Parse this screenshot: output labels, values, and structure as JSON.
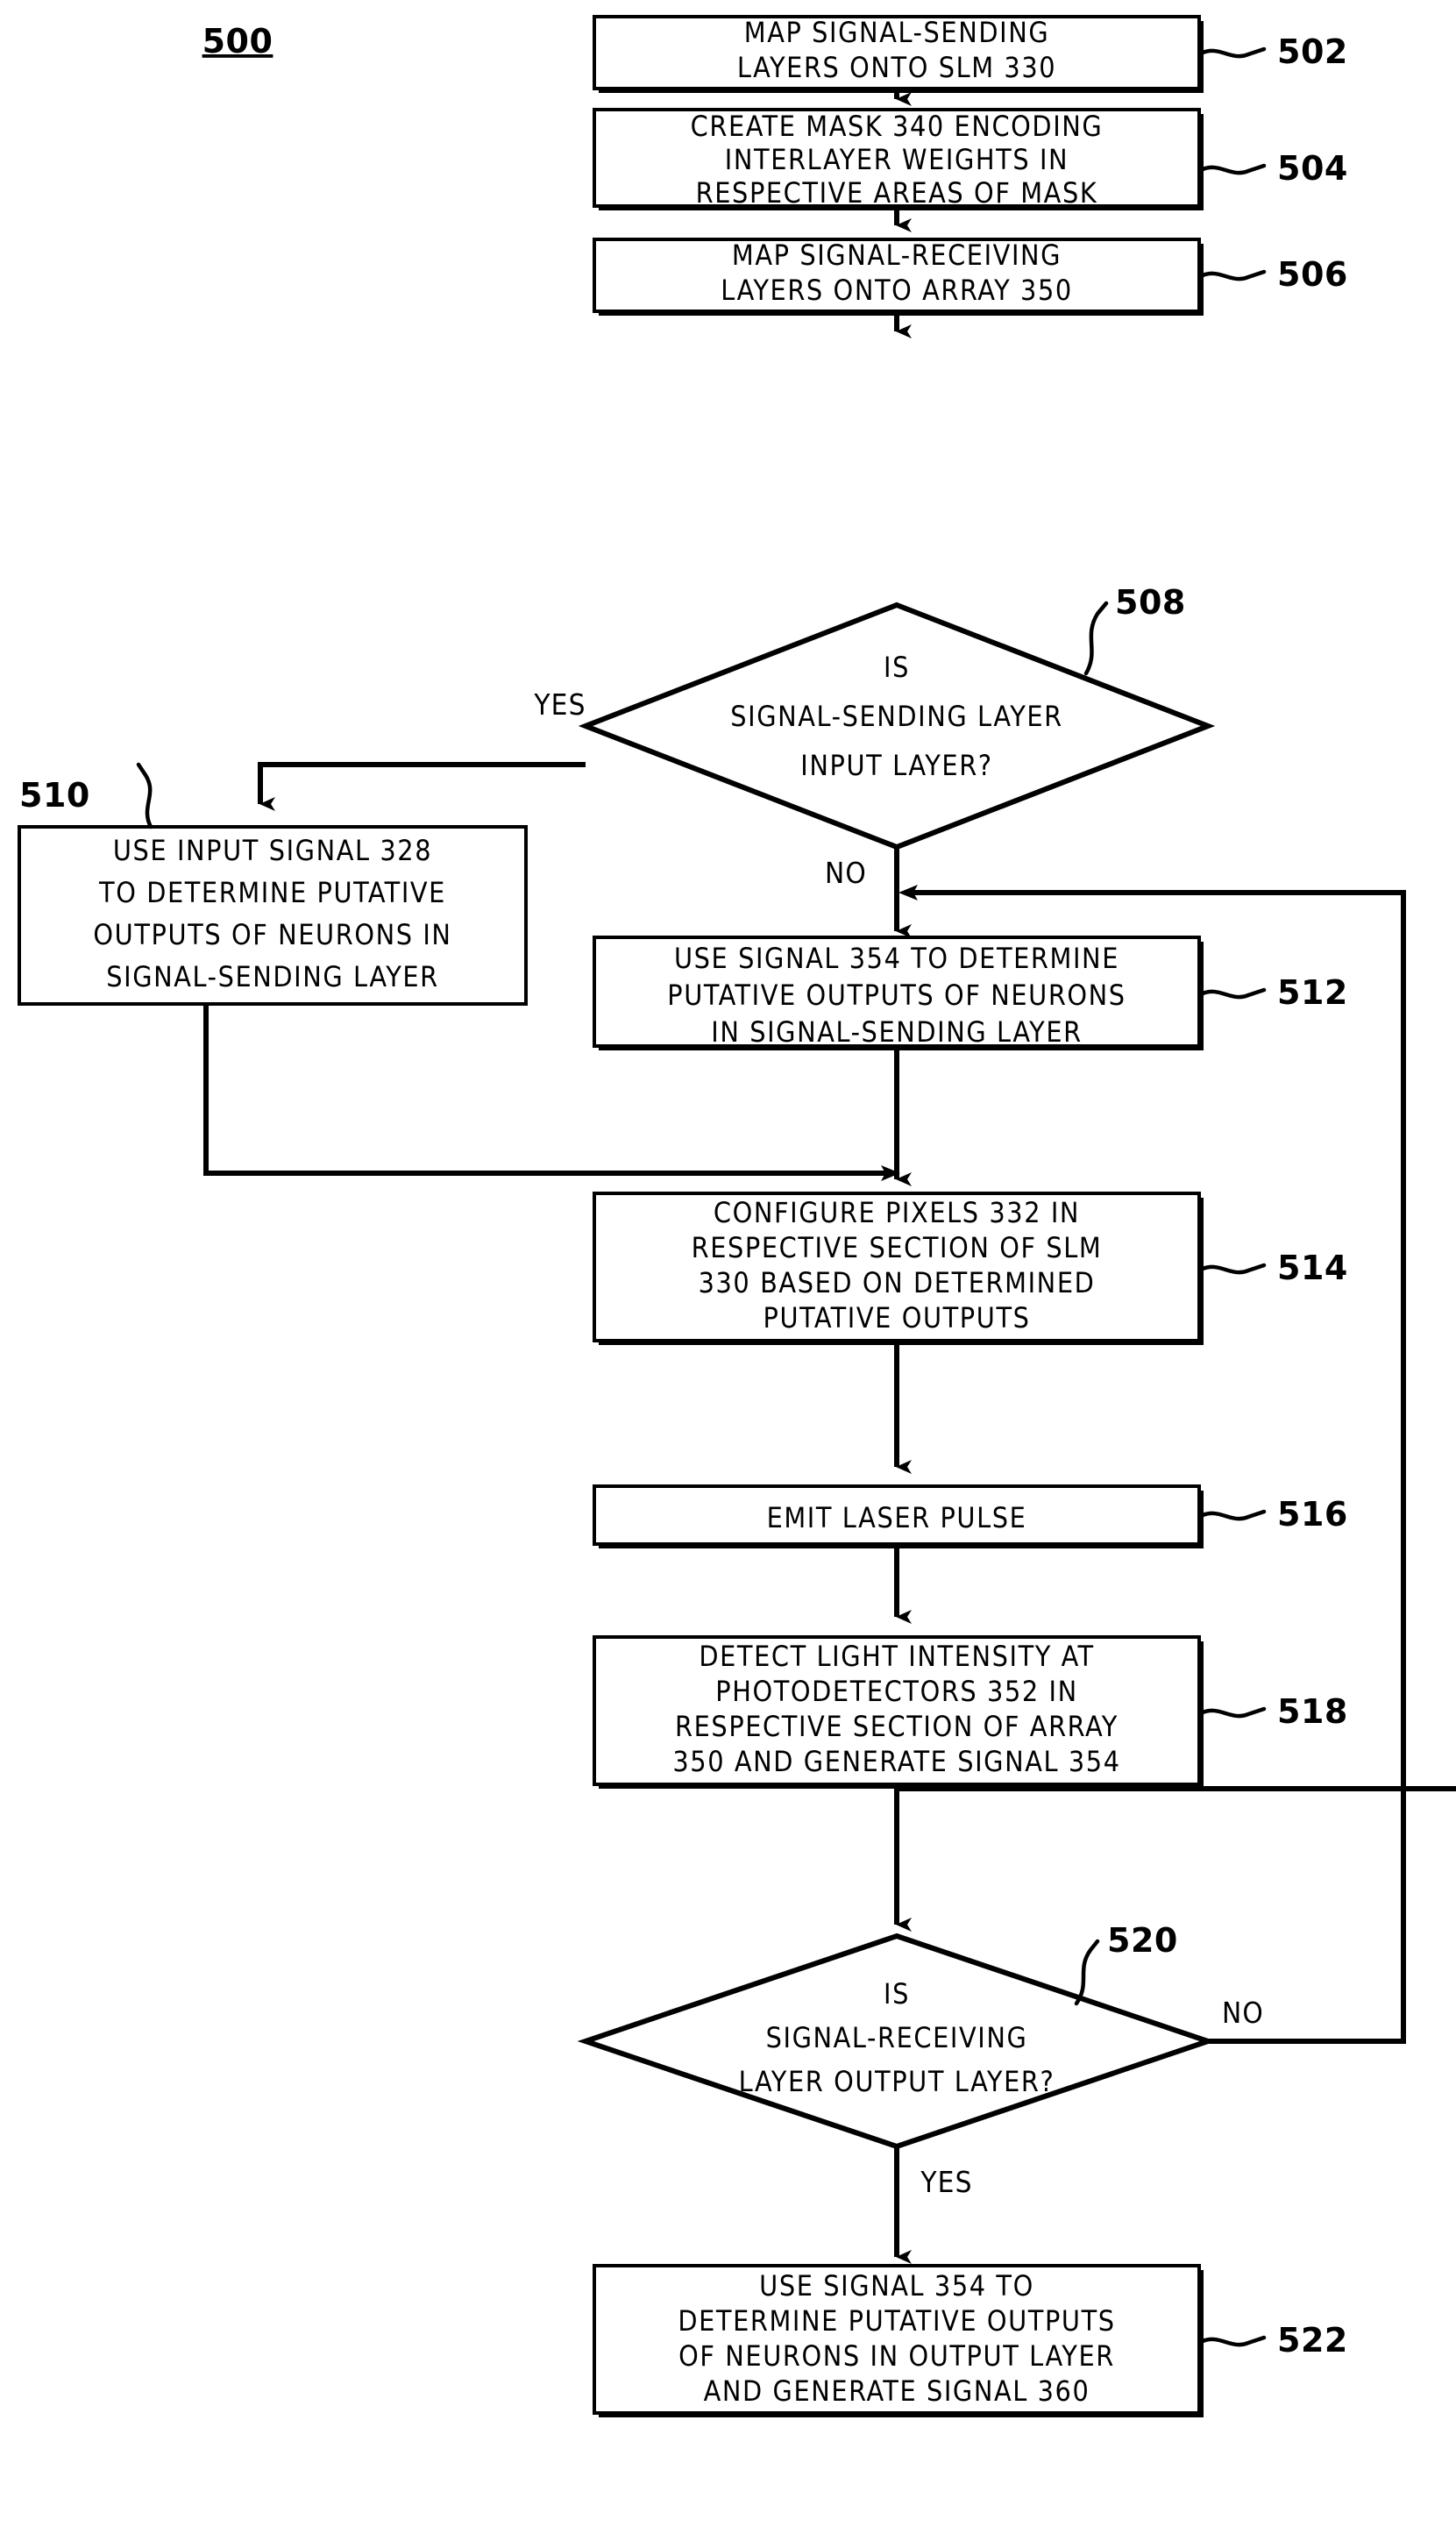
{
  "figure": {
    "number": "500",
    "type": "patent-flowchart",
    "title": ""
  },
  "nodes": [
    {
      "id": "502",
      "shape": "process",
      "ref": "502",
      "lines": [
        "MAP SIGNAL-SENDING",
        "LAYERS ONTO SLM 330"
      ]
    },
    {
      "id": "504",
      "shape": "process",
      "ref": "504",
      "lines": [
        "CREATE MASK 340 ENCODING",
        "INTERLAYER WEIGHTS IN",
        "RESPECTIVE AREAS OF MASK"
      ]
    },
    {
      "id": "506",
      "shape": "process",
      "ref": "506",
      "lines": [
        "MAP SIGNAL-RECEIVING",
        "LAYERS ONTO ARRAY 350"
      ]
    },
    {
      "id": "508",
      "shape": "decision",
      "ref": "508",
      "lines": [
        "IS",
        "SIGNAL-SENDING LAYER",
        "INPUT LAYER?"
      ]
    },
    {
      "id": "510",
      "shape": "process",
      "ref": "510",
      "lines": [
        "USE INPUT SIGNAL 328",
        "TO DETERMINE PUTATIVE",
        "OUTPUTS OF NEURONS IN",
        "SIGNAL-SENDING LAYER"
      ]
    },
    {
      "id": "512",
      "shape": "process",
      "ref": "512",
      "lines": [
        "USE SIGNAL 354 TO DETERMINE",
        "PUTATIVE OUTPUTS OF NEURONS",
        "IN SIGNAL-SENDING LAYER"
      ]
    },
    {
      "id": "514",
      "shape": "process",
      "ref": "514",
      "lines": [
        "CONFIGURE PIXELS 332 IN",
        "RESPECTIVE SECTION OF SLM",
        "330 BASED ON DETERMINED",
        "PUTATIVE OUTPUTS"
      ]
    },
    {
      "id": "516",
      "shape": "process",
      "ref": "516",
      "lines": [
        "EMIT LASER PULSE"
      ]
    },
    {
      "id": "518",
      "shape": "process",
      "ref": "518",
      "lines": [
        "DETECT LIGHT INTENSITY AT",
        "PHOTODETECTORS 352 IN",
        "RESPECTIVE SECTION OF ARRAY",
        "350 AND GENERATE SIGNAL 354"
      ]
    },
    {
      "id": "520",
      "shape": "decision",
      "ref": "520",
      "lines": [
        "IS",
        "SIGNAL-RECEIVING",
        "LAYER OUTPUT LAYER?"
      ]
    },
    {
      "id": "522",
      "shape": "process",
      "ref": "522",
      "lines": [
        "USE SIGNAL 354 TO",
        "DETERMINE PUTATIVE OUTPUTS",
        "OF NEURONS IN OUTPUT LAYER",
        "AND GENERATE SIGNAL 360"
      ]
    }
  ],
  "branch_labels": {
    "d508_yes": "YES",
    "d508_no": "NO",
    "d520_no": "NO",
    "d520_yes": "YES"
  },
  "refs": {
    "r502": "502",
    "r504": "504",
    "r506": "506",
    "r508": "508",
    "r510": "510",
    "r512": "512",
    "r514": "514",
    "r516": "516",
    "r518": "518",
    "r520": "520",
    "r522": "522"
  },
  "colors": {
    "ink": "#000000",
    "paper": "#ffffff"
  }
}
